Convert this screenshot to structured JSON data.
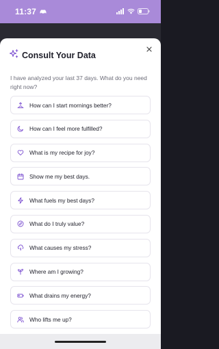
{
  "status_bar": {
    "time": "11:37",
    "icons": [
      "car-icon",
      "signal-icon",
      "wifi-icon",
      "battery-icon"
    ]
  },
  "background_list": {
    "rows": [
      {
        "label": "...",
        "value": "..."
      }
    ]
  },
  "dialog": {
    "title": "Consult Your Data",
    "title_icon": "sparkle-icon",
    "description": "I have analyzed your last 37 days. What do you need right now?",
    "close_icon": "close-icon",
    "options": [
      {
        "icon": "sunrise-icon",
        "label": "How can I start mornings better?"
      },
      {
        "icon": "moon-icon",
        "label": "How can I feel more fulfilled?"
      },
      {
        "icon": "heart-icon",
        "label": "What is my recipe for joy?"
      },
      {
        "icon": "calendar-icon",
        "label": "Show me my best days."
      },
      {
        "icon": "lightning-icon",
        "label": "What fuels my best days?"
      },
      {
        "icon": "compass-icon",
        "label": "What do I truly value?"
      },
      {
        "icon": "storm-cloud-icon",
        "label": "What causes my stress?"
      },
      {
        "icon": "sprout-icon",
        "label": "Where am I growing?"
      },
      {
        "icon": "battery-low-icon",
        "label": "What drains my energy?"
      },
      {
        "icon": "people-icon",
        "label": "Who lifts me up?"
      }
    ]
  },
  "colors": {
    "accent": "#7b4fd0",
    "status_bar_bg": "#a98ad9",
    "option_border": "#e6e4ec",
    "text_primary": "#1f1f2a",
    "text_secondary": "#6c6c78"
  }
}
